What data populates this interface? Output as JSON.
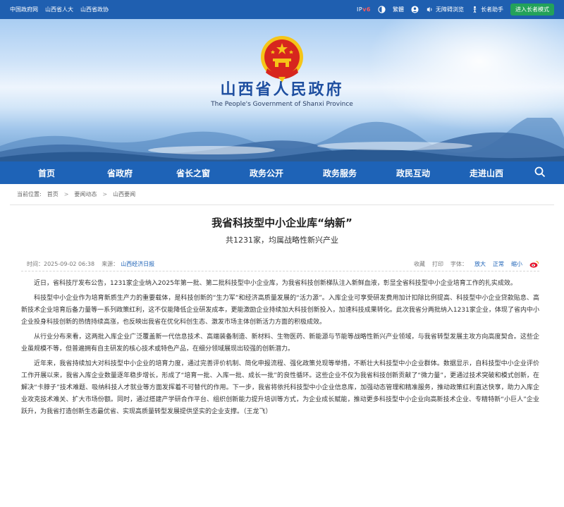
{
  "topbar": {
    "links": [
      "中国政府网",
      "山西省人大",
      "山西省政协"
    ],
    "ipv6_a": "IP",
    "ipv6_b": "v6",
    "traditional": "繁體",
    "accessibility": "无障碍浏览",
    "elder_helper": "长者助手",
    "elder_mode": "进入长者模式"
  },
  "header": {
    "title": "山西省人民政府",
    "subtitle": "The People's Government of Shanxi Province"
  },
  "nav": {
    "items": [
      "首页",
      "省政府",
      "省长之窗",
      "政务公开",
      "政务服务",
      "政民互动",
      "走进山西"
    ]
  },
  "breadcrumb": {
    "label": "当前位置:",
    "items": [
      "首页",
      "要闻动态",
      "山西要闻"
    ],
    "sep": ">"
  },
  "article": {
    "title": "我省科技型中小企业库“纳新”",
    "subtitle": "共1231家，均属战略性新兴产业",
    "time_label": "时间：",
    "time": "2025-09-02 06:38",
    "source_label": "来源：",
    "source": "山西经济日报",
    "tools": {
      "favorite": "收藏",
      "print": "打印",
      "font_label": "字体：",
      "large": "放大",
      "normal": "正常",
      "small": "缩小"
    },
    "paragraphs": [
      "近日，省科技厅发布公告，1231家企业纳入2025年第一批、第二批科技型中小企业库，为我省科技创新梯队注入新鲜血液，彰显全省科技型中小企业培育工作的扎实成效。",
      "科技型中小企业作为培育新质生产力的重要载体，是科技创新的“生力军”和经济高质量发展的“活力源”。入库企业可享受研发费用加计扣除比例提高、科技型中小企业贷款贴息、高新技术企业培育后备力量等一系列政策红利，这不仅能降低企业研发成本，更能激励企业持续加大科技创新投入，加速科技成果转化。此次我省分两批纳入1231家企业，体现了省内中小企业投身科技创新的热情持续高涨，也反映出我省在优化科创生态、激发市场主体创新活力方面的积极成效。",
      "从行业分布来看，这两批入库企业广泛覆盖新一代信息技术、高端装备制造、新材料、生物医药、新能源与节能等战略性新兴产业领域，与我省转型发展主攻方向高度契合。这些企业虽规模不等，但普遍拥有自主研发的核心技术或特色产品，在细分领域展现出较强的创新潜力。",
      "近年来，我省持续加大对科技型中小企业的培育力度，通过完善评价机制、简化申报流程、强化政策兑现等举措，不断壮大科技型中小企业群体。数据显示，自科技型中小企业评价工作开展以来，我省入库企业数量逐年稳步增长，形成了“培育一批、入库一批、成长一批”的良性循环。这些企业不仅为我省科技创新贡献了“微力量”，更通过技术突破和模式创新，在解决“卡脖子”技术难题、吸纳科技人才就业等方面发挥着不可替代的作用。下一步，我省将依托科技型中小企业信息库，加强动态管理和精准服务，推动政策红利直达快享，助力入库企业攻克技术难关、扩大市场份额。同时，通过搭建产学研合作平台、组织创新能力提升培训等方式，为企业成长赋能，推动更多科技型中小企业向高新技术企业、专精特新“小巨人”企业跃升，为我省打造创新生态最优省、实现高质量转型发展提供坚实的企业支撑。（王龙飞）"
    ]
  },
  "colors": {
    "primary": "#1e63b7",
    "topbar": "#1f5fb0",
    "elder_button": "#23a25a",
    "emblem_red": "#d7261e",
    "emblem_gold": "#f5c518"
  }
}
